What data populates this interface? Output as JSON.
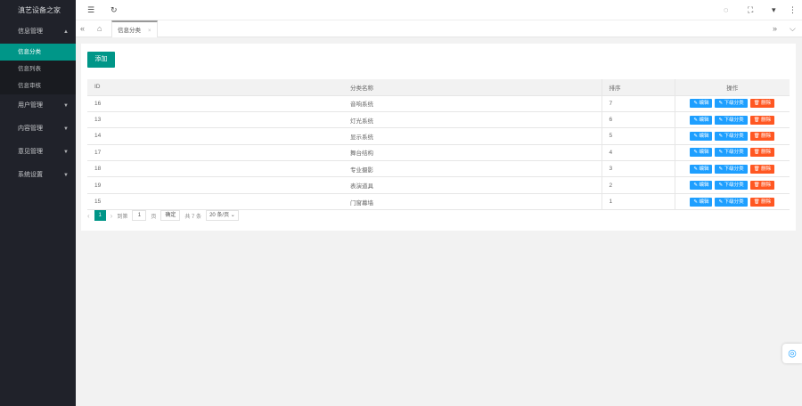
{
  "app": {
    "title": "滇艺设备之家"
  },
  "sidebar": {
    "groups": [
      {
        "label": "信息管理",
        "caret": "▲",
        "items": [
          {
            "label": "信息分类"
          },
          {
            "label": "信息列表"
          },
          {
            "label": "信息审核"
          }
        ]
      },
      {
        "label": "用户管理",
        "caret": "▼"
      },
      {
        "label": "内容管理",
        "caret": "▼"
      },
      {
        "label": "意见管理",
        "caret": "▼"
      },
      {
        "label": "系统设置",
        "caret": "▼"
      }
    ]
  },
  "header": {
    "menu_icon": "☰",
    "refresh_icon": "↻",
    "right_icons": [
      "◌",
      "⛶",
      "▾",
      "⋮"
    ]
  },
  "tabs": {
    "left_nav": "«",
    "home_icon": "⌂",
    "active_label": "信息分类",
    "close": "×",
    "right_nav": "»",
    "dropdown": "⌵"
  },
  "toolbar": {
    "add_label": "添加"
  },
  "table": {
    "headers": [
      "ID",
      "分类名称",
      "排序",
      "操作"
    ],
    "rows": [
      {
        "id": "16",
        "name": "音响系统",
        "sort": "7"
      },
      {
        "id": "13",
        "name": "灯光系统",
        "sort": "6"
      },
      {
        "id": "14",
        "name": "显示系统",
        "sort": "5"
      },
      {
        "id": "17",
        "name": "舞台结构",
        "sort": "4"
      },
      {
        "id": "18",
        "name": "专业摄影",
        "sort": "3"
      },
      {
        "id": "19",
        "name": "表演道具",
        "sort": "2"
      },
      {
        "id": "15",
        "name": "门窗幕墙",
        "sort": "1"
      }
    ],
    "actions": {
      "edit": "✎ 编辑",
      "sub": "✎ 下级分类",
      "delete": "🗑 删除"
    }
  },
  "pager": {
    "prev": "‹",
    "current": "1",
    "next": "›",
    "goto_label": "到第",
    "goto_value": "1",
    "page_unit": "页",
    "confirm": "确定",
    "total": "共 7 条",
    "page_size": "20 条/页"
  },
  "colors": {
    "accent": "#009688",
    "blue": "#1e9fff",
    "red": "#ff5722",
    "sidebar": "#20222a"
  }
}
